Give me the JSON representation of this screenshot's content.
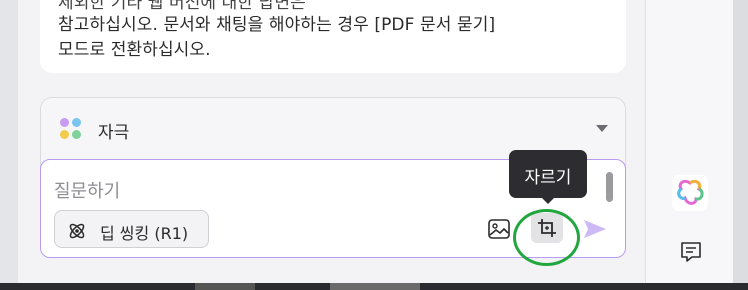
{
  "message": {
    "line0": "제외한 기타 웹 버전에 대한 답변은",
    "line1": "참고하십시오. 문서와 채팅을 해야하는 경우 [PDF 문서 묻기]",
    "line2": "모드로 전환하십시오."
  },
  "compose": {
    "stimulus_label": "자극",
    "input_placeholder": "질문하기",
    "deep_thinking_label": "딥 씽킹 (R1)"
  },
  "tooltip": {
    "crop_label": "자르기"
  },
  "icons": {
    "stimulus": "four-dots-icon",
    "dropdown": "caret-down-icon",
    "deep_thinking": "atom-icon",
    "image": "image-icon",
    "crop": "crop-icon",
    "send": "send-icon",
    "app": "app-logo-icon",
    "chat": "chat-icon"
  },
  "colors": {
    "accent": "#b89af0",
    "highlight": "#22a73f",
    "tooltip_bg": "#2d2d31"
  }
}
